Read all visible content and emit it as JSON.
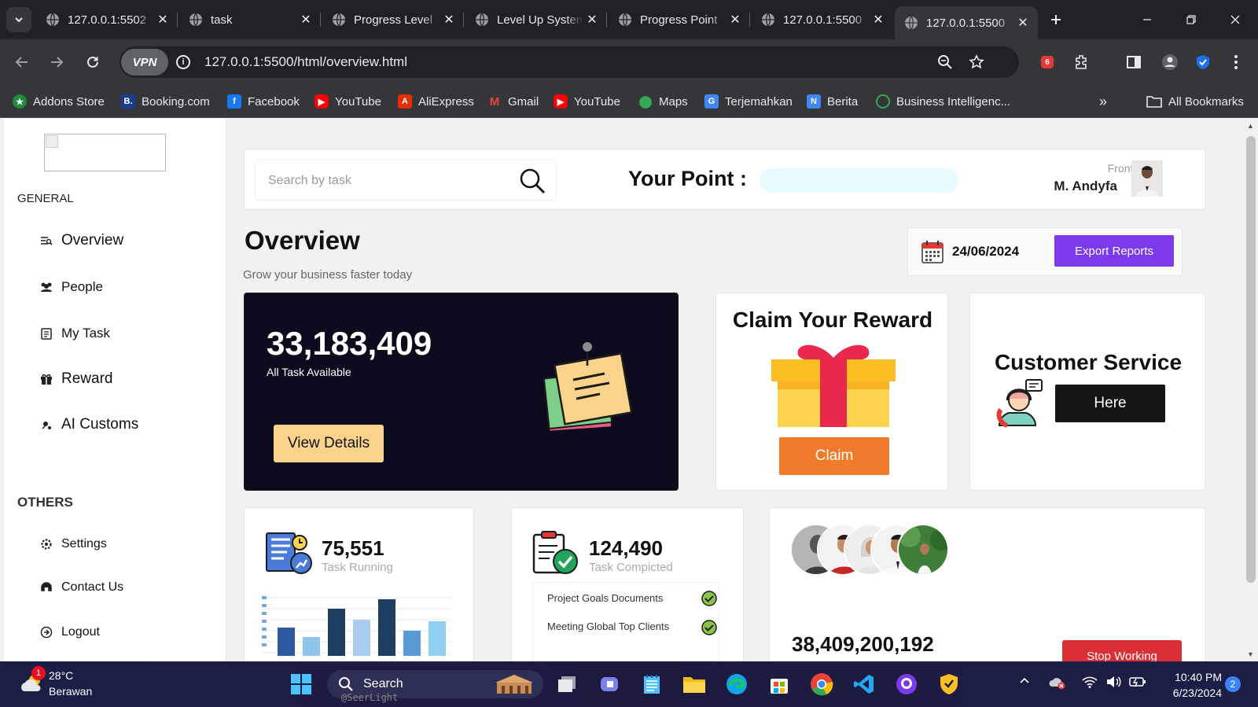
{
  "browser": {
    "tabs": [
      {
        "title": "127.0.0.1:5502",
        "active": false
      },
      {
        "title": "task",
        "active": false
      },
      {
        "title": "Progress Level",
        "active": false
      },
      {
        "title": "Level Up System",
        "active": false
      },
      {
        "title": "Progress Point",
        "active": false
      },
      {
        "title": "127.0.0.1:5500",
        "active": false
      },
      {
        "title": "127.0.0.1:5500",
        "active": true
      }
    ],
    "vpn_label": "VPN",
    "url": "127.0.0.1:5500/html/overview.html",
    "extension_badge": "6",
    "bookmarks": [
      {
        "label": "Addons Store",
        "icon": "addons-icon",
        "color": "#1e8e3e"
      },
      {
        "label": "Booking.com",
        "icon": "booking-icon",
        "color": "#1a3d8f"
      },
      {
        "label": "Facebook",
        "icon": "facebook-icon",
        "color": "#1877f2"
      },
      {
        "label": "YouTube",
        "icon": "youtube-icon",
        "color": "#ff0000"
      },
      {
        "label": "AliExpress",
        "icon": "aliexpress-icon",
        "color": "#e62e04"
      },
      {
        "label": "Gmail",
        "icon": "gmail-icon",
        "color": "#ea4335"
      },
      {
        "label": "YouTube",
        "icon": "youtube-icon",
        "color": "#ff0000"
      },
      {
        "label": "Maps",
        "icon": "maps-icon",
        "color": "#34a853"
      },
      {
        "label": "Terjemahkan",
        "icon": "translate-icon",
        "color": "#4285f4"
      },
      {
        "label": "Berita",
        "icon": "news-icon",
        "color": "#4285f4"
      },
      {
        "label": "Business Intelligenc...",
        "icon": "bi-icon",
        "color": "#34a853"
      }
    ],
    "all_bookmarks": "All Bookmarks"
  },
  "sidebar": {
    "general_label": "GENERAL",
    "others_label": "OTHERS",
    "general_items": [
      {
        "label": "Overview",
        "icon": "overview-icon"
      },
      {
        "label": "People",
        "icon": "people-icon"
      },
      {
        "label": "My Task",
        "icon": "task-icon"
      },
      {
        "label": "Reward",
        "icon": "gift-icon"
      },
      {
        "label": "AI Customs",
        "icon": "ai-icon"
      }
    ],
    "other_items": [
      {
        "label": "Settings",
        "icon": "settings-icon"
      },
      {
        "label": "Contact Us",
        "icon": "contact-icon"
      },
      {
        "label": "Logout",
        "icon": "logout-icon"
      }
    ]
  },
  "topbar": {
    "search_placeholder": "Search by task",
    "your_point_label": "Your Point :",
    "user_role": "Front-End",
    "user_name": "M. Andyfa"
  },
  "overview": {
    "title": "Overview",
    "subtitle": "Grow your business faster today",
    "date": "24/06/2024",
    "export_label": "Export Reports"
  },
  "task_card": {
    "count": "33,183,409",
    "label": "All Task Available",
    "button": "View Details"
  },
  "reward_card": {
    "title": "Claim Your Reward",
    "button": "Claim"
  },
  "cs_card": {
    "title": "Customer Service",
    "button": "Here"
  },
  "running_card": {
    "count": "75,551",
    "label": "Task Running"
  },
  "completed_card": {
    "count": "124,490",
    "label": "Task Compicted",
    "items": [
      "Project Goals Documents",
      "Meeting Global Top Clients"
    ]
  },
  "team_card": {
    "count": "38,409,200,192",
    "button": "Stop Working"
  },
  "taskbar": {
    "temperature": "28°C",
    "condition": "Berawan",
    "weather_badge": "1",
    "search_label": "Search",
    "watermark": "@SeerLight",
    "time": "10:40 PM",
    "date": "6/23/2024",
    "notification_count": "2"
  },
  "colors": {
    "accent_purple": "#7c3aed",
    "claim_orange": "#ee7a2a",
    "view_yellow": "#fcd38a",
    "stop_red": "#dc2e35",
    "task_card_bg": "#0e0a1e"
  }
}
